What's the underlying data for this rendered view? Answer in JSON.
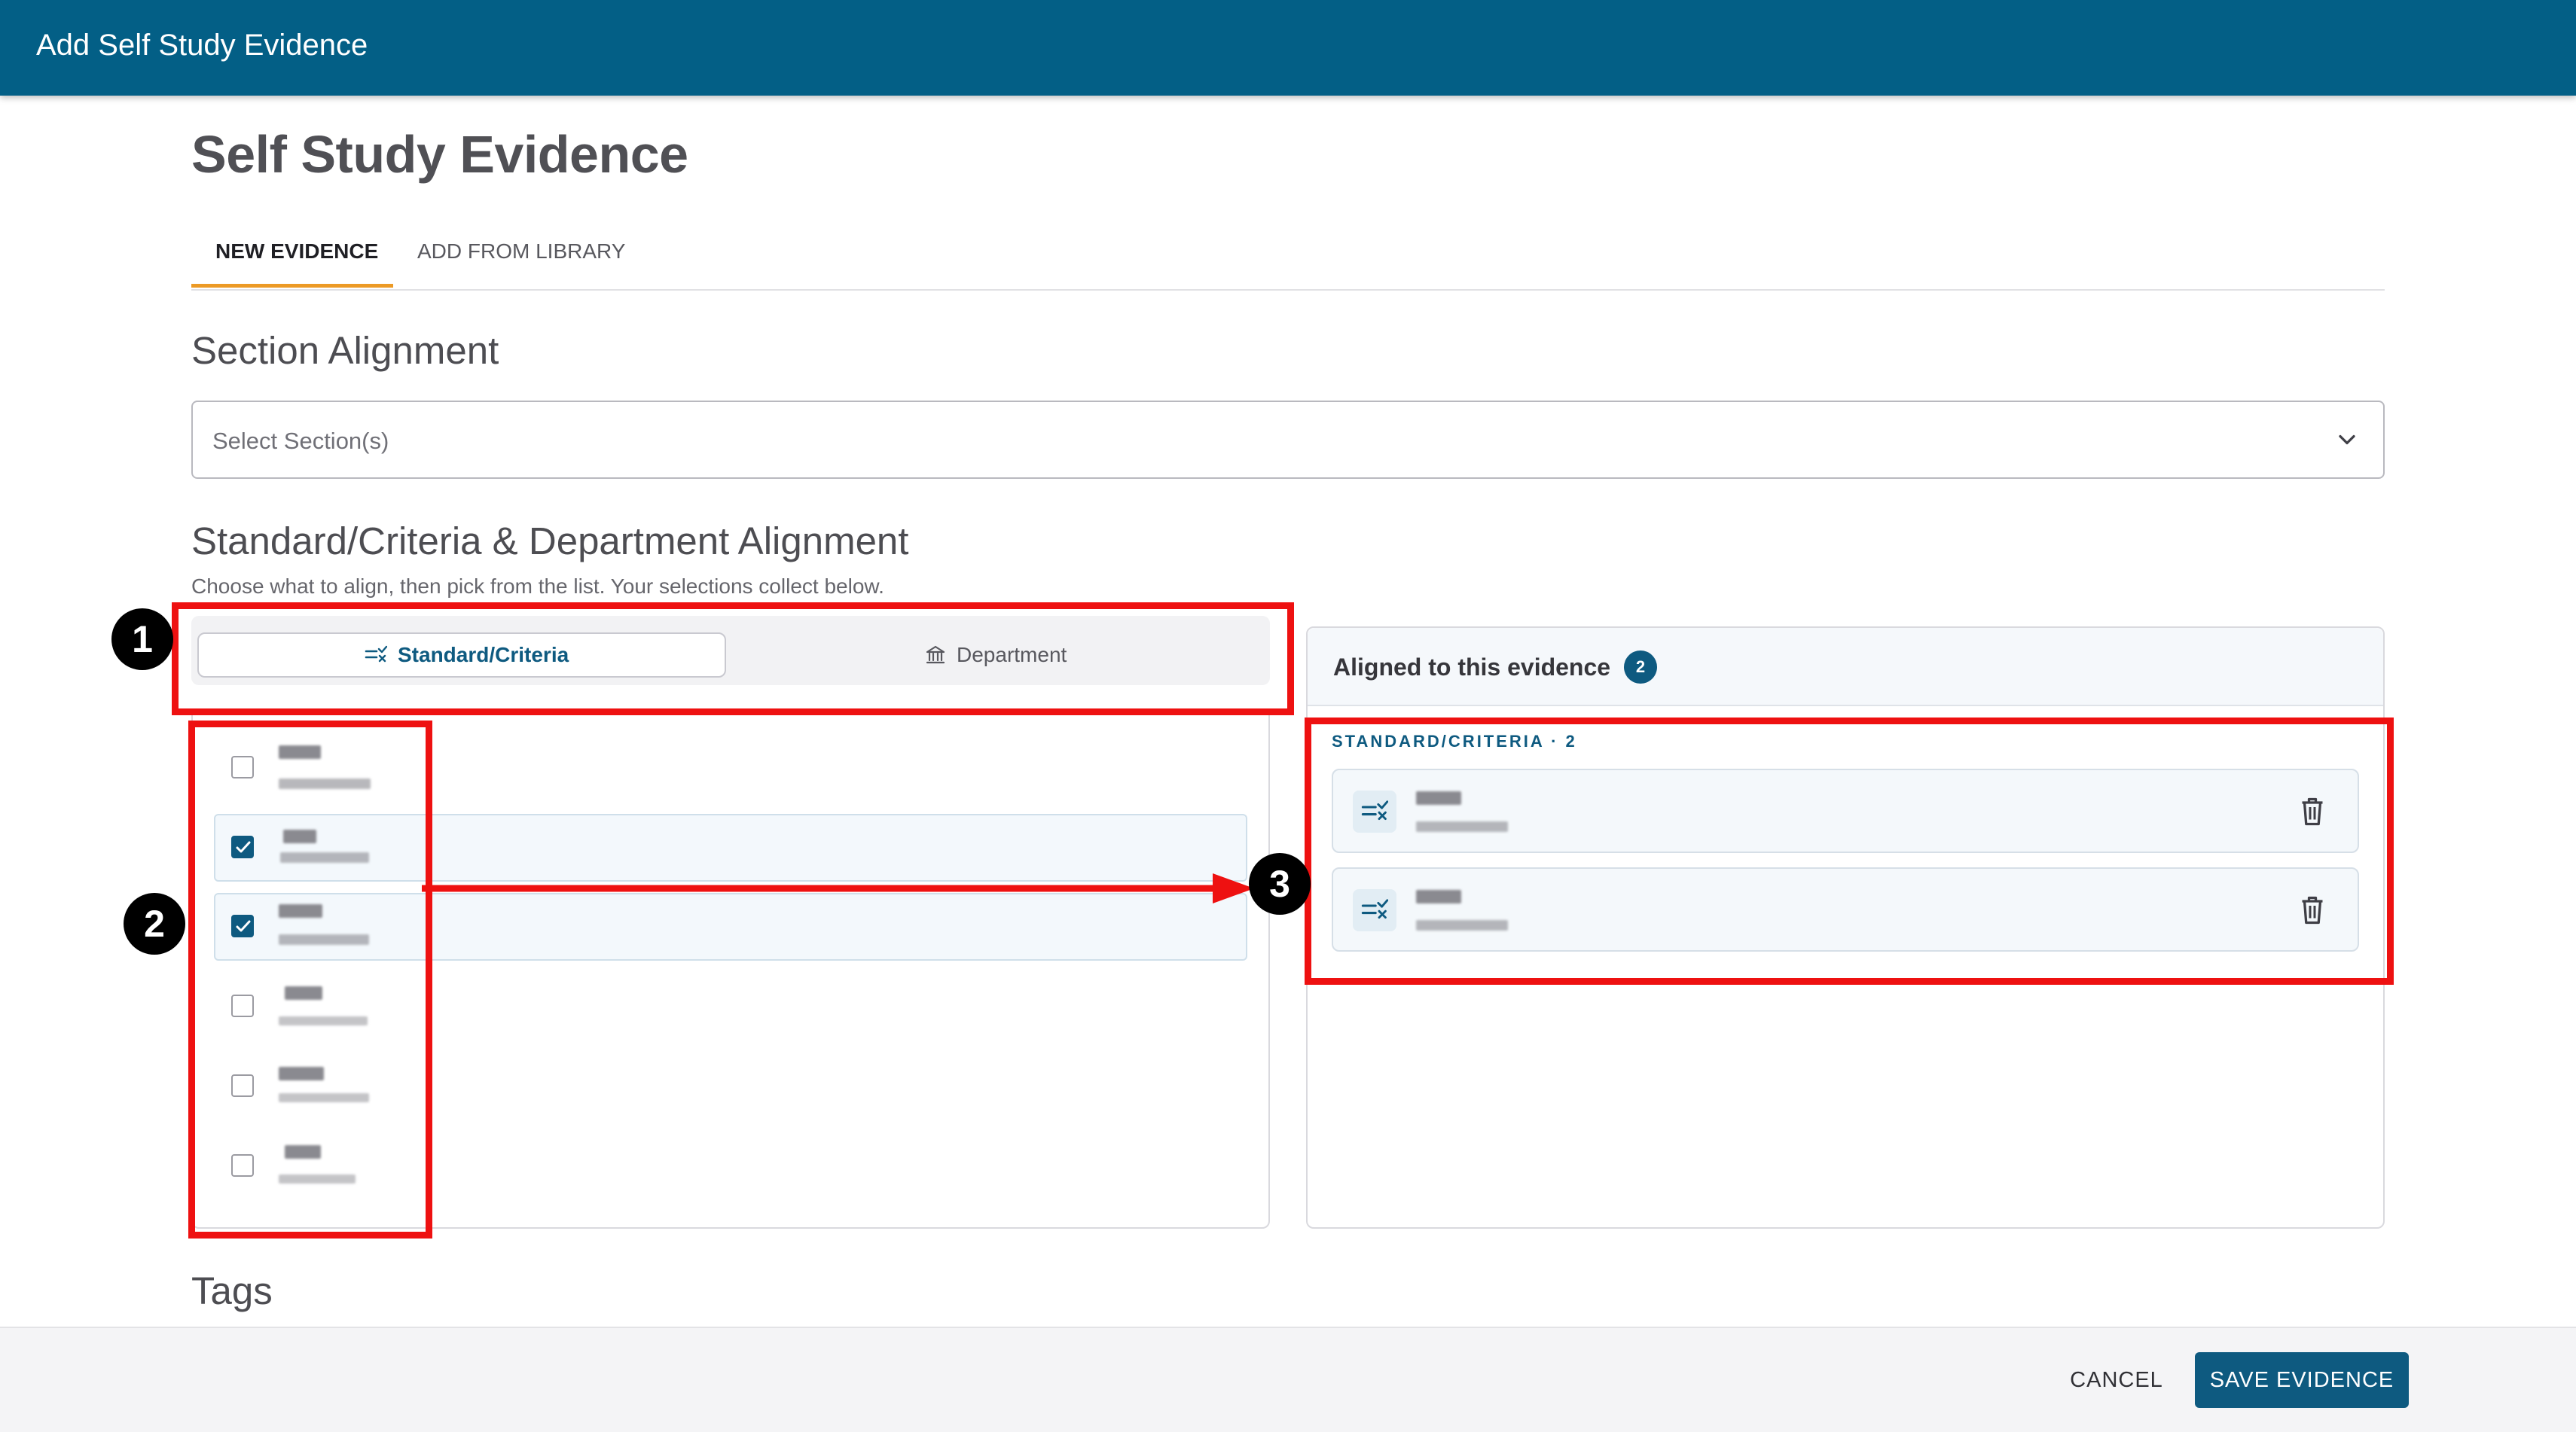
{
  "app": {
    "window_title": "Add Self Study Evidence"
  },
  "page": {
    "title": "Self Study Evidence"
  },
  "tabs": [
    {
      "label": "NEW EVIDENCE",
      "active": true
    },
    {
      "label": "ADD FROM LIBRARY",
      "active": false
    }
  ],
  "section_alignment": {
    "heading": "Section Alignment",
    "select_placeholder": "Select Section(s)"
  },
  "standard_alignment": {
    "heading": "Standard/Criteria & Department Alignment",
    "helper": "Choose what to align, then pick from the list. Your selections collect below.",
    "toggle": [
      {
        "label": "Standard/Criteria",
        "icon": "checklist-icon",
        "selected": true
      },
      {
        "label": "Department",
        "icon": "institution-icon",
        "selected": false
      }
    ],
    "list_items": [
      {
        "checked": false
      },
      {
        "checked": true
      },
      {
        "checked": true
      },
      {
        "checked": false
      },
      {
        "checked": false
      },
      {
        "checked": false
      }
    ]
  },
  "aligned": {
    "title": "Aligned to this evidence",
    "count": "2",
    "group_label": "STANDARD/CRITERIA · 2",
    "items": [
      {
        "icon": "checklist-icon"
      },
      {
        "icon": "checklist-icon"
      }
    ]
  },
  "tags": {
    "heading": "Tags"
  },
  "footer": {
    "cancel_label": "CANCEL",
    "save_label": "SAVE EVIDENCE"
  },
  "annotations": {
    "marker_1": "1",
    "marker_2": "2",
    "marker_3": "3"
  },
  "colors": {
    "primary": "#0e5a80",
    "header": "#035f86",
    "tab_accent": "#ec9a25",
    "annotation": "#ee1111"
  }
}
